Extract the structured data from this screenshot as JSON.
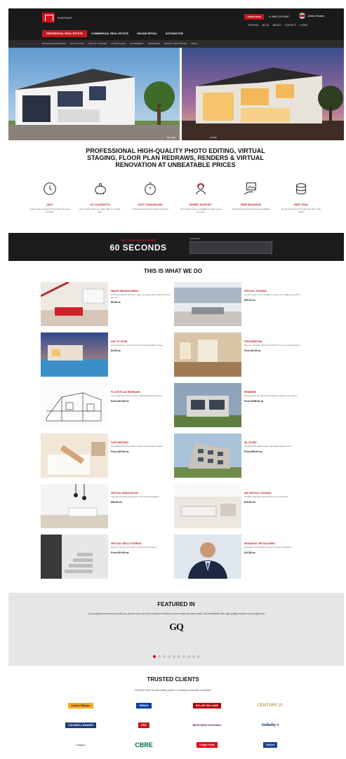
{
  "header": {
    "logo_text": "PHOTOUP",
    "order_button": "ORDER NOW",
    "phone": "+1 555 123 4567",
    "language": "United States",
    "utility_links": [
      "PRICING",
      "BLOG",
      "ABOUT",
      "CONTACT",
      "LOGIN"
    ],
    "main_nav": [
      "RESIDENTIAL REAL ESTATE",
      "COMMERCIAL REAL ESTATE",
      "ONLINE RETAIL",
      "AUTOMOTIVE"
    ],
    "sub_nav": [
      "IMAGE ENHANCEMENT",
      "DAY TO DUSK",
      "VIRTUAL STAGING",
      "FLOOR PLANS",
      "3D RENDERS",
      "PANORAMA",
      "VIRTUAL RENOVATION",
      "VIDEO"
    ]
  },
  "hero": {
    "left_caption": "BEFORE",
    "right_caption": "AFTER"
  },
  "headline": "PROFESSIONAL HIGH-QUALITY PHOTO EDITING, VIRTUAL STAGING, FLOOR PLAN REDRAWS, RENDERS & VIRTUAL RENOVATION AT UNBEATABLE PRICES",
  "features": [
    {
      "icon": "clock-24-icon",
      "title": "24H/7",
      "text": "Choose the turnaround time that suits your workflow"
    },
    {
      "icon": "piggy-bank-icon",
      "title": "NO CONTRACTS",
      "text": "Pay only for what you order with no monthly fees"
    },
    {
      "icon": "stopwatch-icon",
      "title": "FAST TURNAROUND",
      "text": "Orders delivered in as fast as 24 hours"
    },
    {
      "icon": "support-agent-icon",
      "title": "EXPERT SUPPORT",
      "text": "Our support team is available to help you at any time"
    },
    {
      "icon": "image-hand-icon",
      "title": "FREE REVISIONS",
      "text": "Unlimited revisions until you are satisfied"
    },
    {
      "icon": "coin-stack-icon",
      "title": "FREE TRIAL",
      "text": "Try our service for free with your first order today"
    }
  ],
  "cta": {
    "small": "GET STARTED IN UNDER",
    "big": "60 SECONDS",
    "form_label": "Your Email",
    "input_placeholder": ""
  },
  "services_title": "THIS IS WHAT WE DO",
  "services": [
    {
      "name": "IMAGE ENHANCEMENT",
      "desc": "Professional photo editing to make your listing photos stand out from the rest.",
      "price": "$0.89 ea",
      "thumb": "living-room"
    },
    {
      "name": "VIRTUAL STAGING",
      "desc": "Furnish empty rooms virtually so buyers can imagine living there.",
      "price": "$29.00 ea",
      "thumb": "living-room-2"
    },
    {
      "name": "DAY TO DUSK",
      "desc": "Convert daytime exterior shots into stunning twilight images.",
      "price": "$3.99 ea",
      "thumb": "pool"
    },
    {
      "name": "ITEM REMOVAL",
      "desc": "Remove unwanted objects and clutter from your property photos.",
      "price": "From $3.99 ea",
      "thumb": "empty-room"
    },
    {
      "name": "FLOOR PLAN REDRAWS",
      "desc": "Turn rough sketches into clean, professional 2D floor plans.",
      "price": "From $19.99 ea",
      "thumb": "sketch"
    },
    {
      "name": "RENDERS",
      "desc": "Photorealistic 3D exterior and interior renders for any project.",
      "price": "From $299.00 ea",
      "thumb": "exterior"
    },
    {
      "name": "COPYWRITING",
      "desc": "Compelling listing descriptions written by real estate experts.",
      "price": "From $29.00 ea",
      "thumb": "writing"
    },
    {
      "name": "3D TOURS",
      "desc": "Interactive 3D walkthroughs that engage buyers online.",
      "price": "From $99.00 ea",
      "thumb": "building"
    },
    {
      "name": "VIRTUAL RENOVATION",
      "desc": "Show the potential of a property with virtual renovations.",
      "price": "$69.00 ea",
      "thumb": "kitchen"
    },
    {
      "name": "360 VIRTUAL STAGING",
      "desc": "Virtually stage 360 panoramas for immersive tours.",
      "price": "$79.00 ea",
      "thumb": "lounge"
    },
    {
      "name": "VIRTUAL DECLUTTERING",
      "desc": "Remove furniture and clutter to present clean spaces.",
      "price": "From $19.99 ea",
      "thumb": "staircase"
    },
    {
      "name": "HEADSHOT RETOUCHING",
      "desc": "Professional retouching for agent and team headshots.",
      "price": "$14.99 ea",
      "thumb": "headshot"
    }
  ],
  "featured": {
    "title": "FEATURED IN",
    "text": "Choosing the best team to edit your photos was one of the hardest decisions I ever made and they made it all worthwhile with high quality results every single time.",
    "logo": "GQ",
    "dots": 10,
    "active_dot": 0
  },
  "clients": {
    "title": "TRUSTED CLIENTS",
    "subtitle": "PhotoUp is the trusted editing partner of leading companies worldwide",
    "logos": [
      {
        "name": "Coldwell Banker",
        "bg": "#f7a823"
      },
      {
        "name": "RE/MAX",
        "bg": "#003da5"
      },
      {
        "name": "KELLER WILLIAMS",
        "bg": "#b40101"
      },
      {
        "name": "CENTURY 21",
        "bg": "#ffffff"
      },
      {
        "name": "COLDWELL BANKER",
        "bg": "#1f3c7a"
      },
      {
        "name": "ERA",
        "bg": "#c8161d"
      },
      {
        "name": "BERKSHIRE HATHAWAY",
        "bg": "#ffffff"
      },
      {
        "name": "Sotheby's",
        "bg": "#ffffff"
      },
      {
        "name": "Compass",
        "bg": "#ffffff"
      },
      {
        "name": "CBRE",
        "bg": "#ffffff"
      },
      {
        "name": "Knight Frank",
        "bg": "#e0001a"
      },
      {
        "name": "Colliers",
        "bg": "#1a3f8f"
      }
    ]
  },
  "colors": {
    "accent": "#c8161d",
    "dark": "#1a1a1a"
  }
}
